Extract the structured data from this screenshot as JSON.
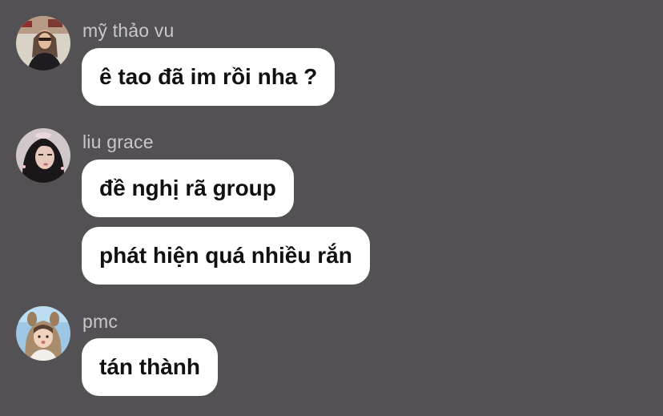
{
  "theme": {
    "background": "#535154",
    "bubble_color": "#ffffff",
    "name_color": "#c9c7ca"
  },
  "messages": [
    {
      "sender": "mỹ thảo vu",
      "avatar": "avatar-photo",
      "bubbles": [
        "ê tao đã im rồi nha ?"
      ]
    },
    {
      "sender": "liu grace",
      "avatar": "avatar-photo",
      "bubbles": [
        "đề nghị rã group",
        "phát hiện quá nhiều rắn"
      ]
    },
    {
      "sender": "pmc",
      "avatar": "avatar-photo",
      "bubbles": [
        "tán thành"
      ]
    }
  ]
}
